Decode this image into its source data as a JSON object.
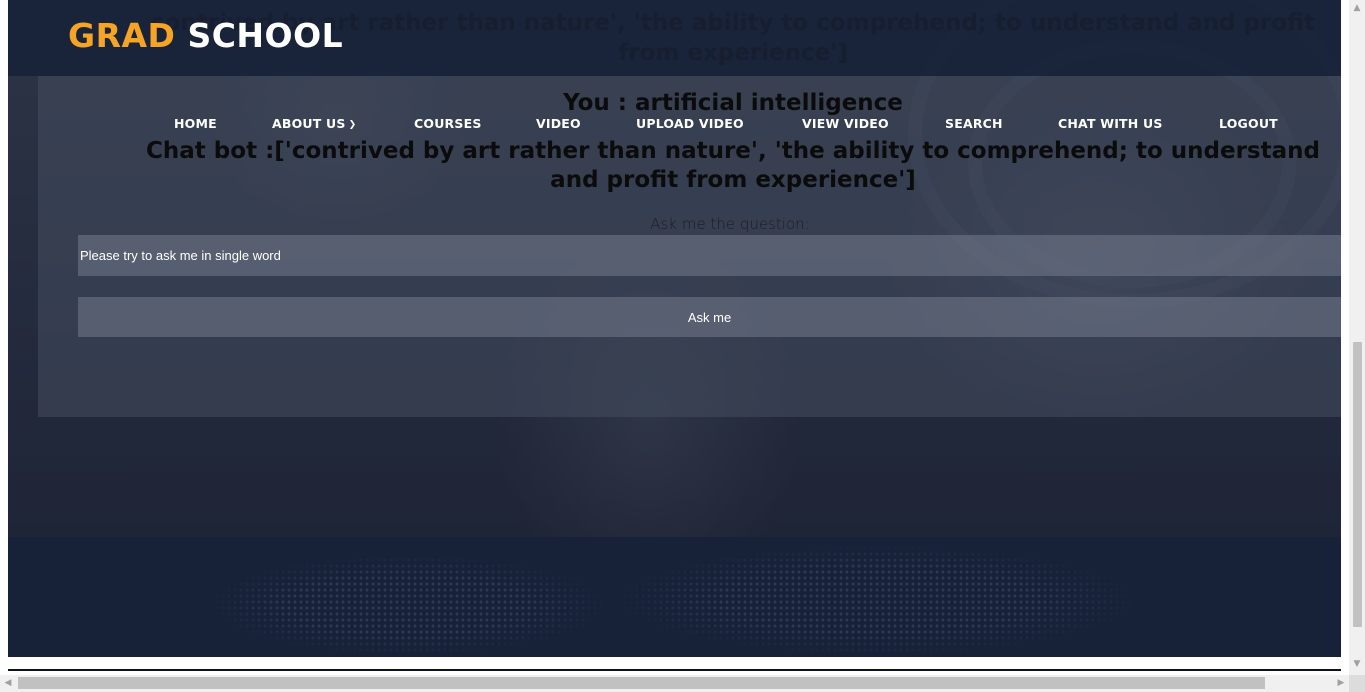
{
  "brand": {
    "part1": "GRAD",
    "part2": "SCHOOL",
    "accent_color": "#f5a425"
  },
  "nav": {
    "items": [
      {
        "label": "HOME"
      },
      {
        "label": "ABOUT US",
        "has_dropdown": true
      },
      {
        "label": "COURSES"
      },
      {
        "label": "VIDEO"
      },
      {
        "label": "UPLOAD VIDEO"
      },
      {
        "label": "VIEW VIDEO"
      },
      {
        "label": "SEARCH"
      },
      {
        "label": "CHAT WITH US"
      },
      {
        "label": "LOGOUT"
      }
    ]
  },
  "chat": {
    "ghost_text": "contrived by art rather than nature', 'the ability to comprehend; to understand and profit from experience']",
    "user_line": "You : artificial intelligence",
    "bot_line": "Chat bot :['contrived by art rather than nature', 'the ability to comprehend; to understand and profit from experience']",
    "ask_label": "Ask me the question:",
    "input_placeholder": "Please try to ask me in single word",
    "button_label": "Ask me"
  },
  "icons": {
    "dropdown": "chevron-down-icon"
  }
}
